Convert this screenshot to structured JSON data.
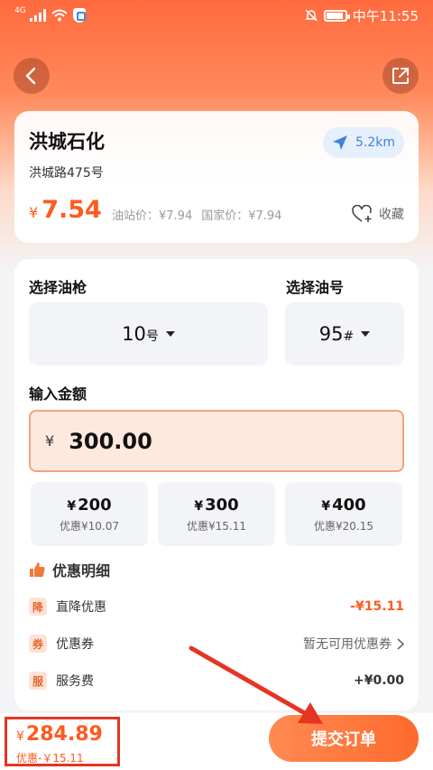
{
  "status_bar": {
    "network": "4G",
    "time": "中午11:55"
  },
  "station": {
    "name": "洪城石化",
    "address": "洪城路475号",
    "distance": "5.2km",
    "price_currency": "¥",
    "price": "7.54",
    "station_price": "油站价：¥7.94",
    "national_price": "国家价：¥7.94",
    "favorite_label": "收藏"
  },
  "order": {
    "gun_title": "选择油枪",
    "gun_value": "10",
    "gun_unit": "号",
    "oil_title": "选择油号",
    "oil_value": "95",
    "oil_unit": "#",
    "amount_title": "输入金额",
    "amount_currency": "¥",
    "amount_value": "300.00",
    "quick_amounts": [
      {
        "currency": "¥",
        "amount": "200",
        "discount": "优惠¥10.07"
      },
      {
        "currency": "¥",
        "amount": "300",
        "discount": "优惠¥15.11"
      },
      {
        "currency": "¥",
        "amount": "400",
        "discount": "优惠¥20.15"
      }
    ],
    "discount_title": "优惠明细",
    "discounts": [
      {
        "badge": "降",
        "label": "直降优惠",
        "value": "-¥15.11"
      },
      {
        "badge": "券",
        "label": "优惠券",
        "value": "暂无可用优惠券"
      },
      {
        "badge": "服",
        "label": "服务费",
        "value": "+¥0.00"
      }
    ]
  },
  "footer": {
    "total_currency": "¥",
    "total": "284.89",
    "saved": "优惠-￥15.11",
    "submit_label": "提交订单"
  },
  "colors": {
    "accent": "#ff5a1f",
    "annotation": "#e53522",
    "distance_blue": "#3f82e0"
  }
}
